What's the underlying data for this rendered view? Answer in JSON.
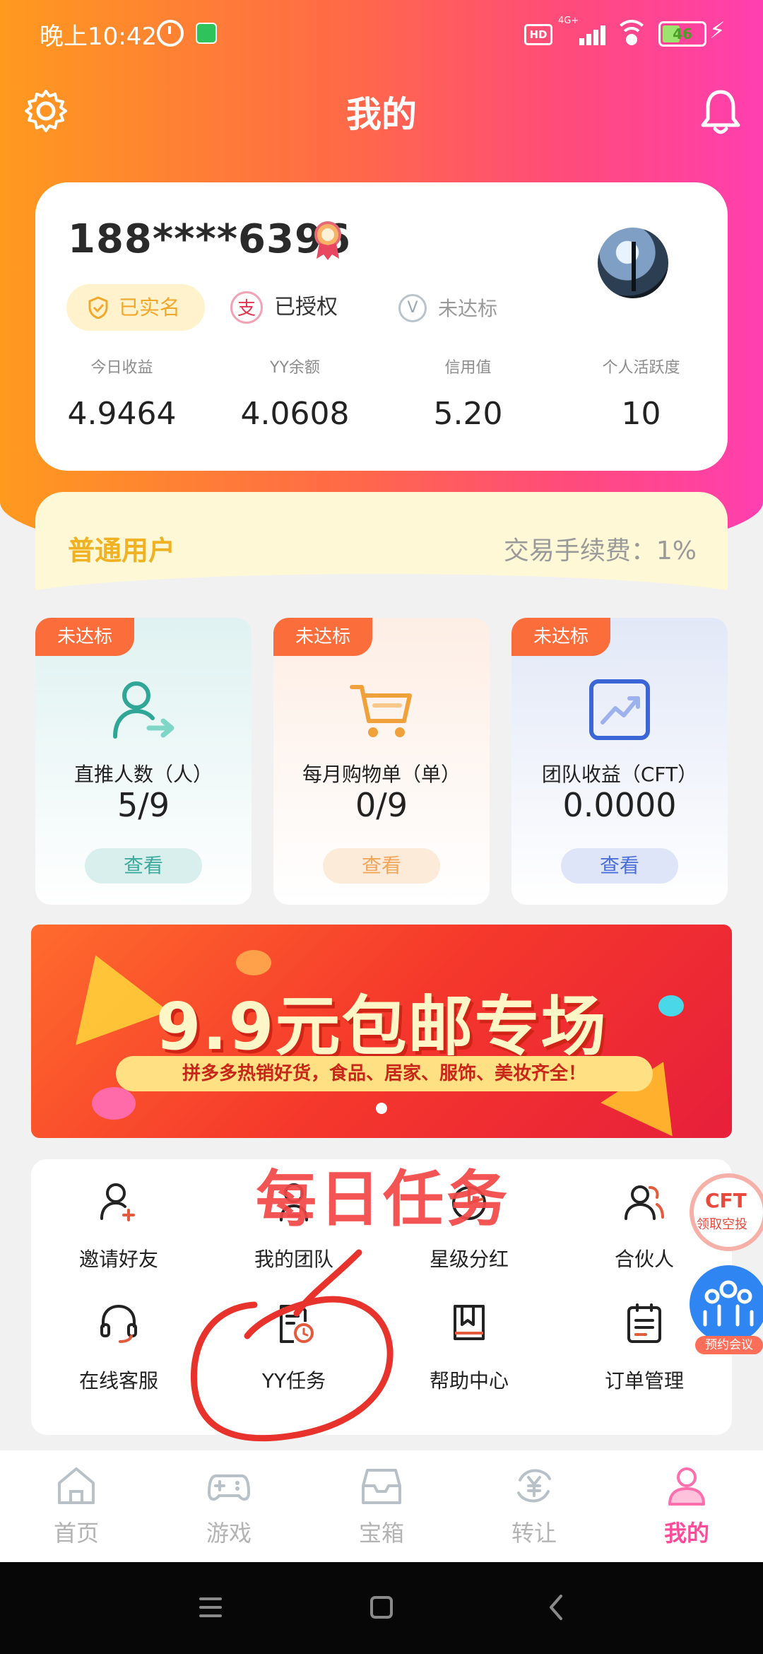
{
  "status_bar": {
    "time": "晚上10:42",
    "network": "4G+",
    "hd": "HD",
    "battery": "46"
  },
  "header": {
    "title": "我的"
  },
  "profile": {
    "phone": "188****6396",
    "badges": {
      "verified": "已实名",
      "authorized": "已授权",
      "rank": "未达标"
    },
    "stats": [
      {
        "label": "今日收益",
        "value": "4.9464"
      },
      {
        "label": "YY余额",
        "value": "4.0608"
      },
      {
        "label": "信用值",
        "value": "5.20"
      },
      {
        "label": "个人活跃度",
        "value": "10"
      }
    ]
  },
  "level": {
    "name": "普通用户",
    "fee": "交易手续费：1%"
  },
  "task_cards": [
    {
      "tag": "未达标",
      "label": "直推人数（人）",
      "value": "5/9",
      "button": "查看"
    },
    {
      "tag": "未达标",
      "label": "每月购物单（单）",
      "value": "0/9",
      "button": "查看"
    },
    {
      "tag": "未达标",
      "label": "团队收益（CFT）",
      "value": "0.0000",
      "button": "查看"
    }
  ],
  "banner": {
    "title": "9.9元包邮专场",
    "subtitle": "拼多多热销好货，食品、居家、服饰、美妆齐全！"
  },
  "menu": [
    {
      "label": "邀请好友",
      "icon": "invite-user-icon"
    },
    {
      "label": "我的团队",
      "icon": "team-icon"
    },
    {
      "label": "星级分红",
      "icon": "pie-chart-icon"
    },
    {
      "label": "合伙人",
      "icon": "partner-icon"
    },
    {
      "label": "在线客服",
      "icon": "headset-icon"
    },
    {
      "label": "YY任务",
      "icon": "task-clock-icon"
    },
    {
      "label": "帮助中心",
      "icon": "book-icon"
    },
    {
      "label": "订单管理",
      "icon": "clipboard-icon"
    }
  ],
  "annotation": {
    "text": "每日任务",
    "color": "#f24747"
  },
  "floating": {
    "cft_big": "CFT",
    "cft_small": "领取空投",
    "meeting": "预约会议"
  },
  "tabbar": [
    {
      "label": "首页",
      "icon": "home-icon"
    },
    {
      "label": "游戏",
      "icon": "gamepad-icon"
    },
    {
      "label": "宝箱",
      "icon": "inbox-icon"
    },
    {
      "label": "转让",
      "icon": "yen-exchange-icon"
    },
    {
      "label": "我的",
      "icon": "profile-icon",
      "active": true
    }
  ],
  "colors": {
    "accent_pink": "#ff4b9a",
    "gradient_start": "#ff9a1e",
    "gradient_end": "#ff3fb0",
    "tag_orange": "#fb6d3a",
    "level_gold": "#f0b222"
  }
}
